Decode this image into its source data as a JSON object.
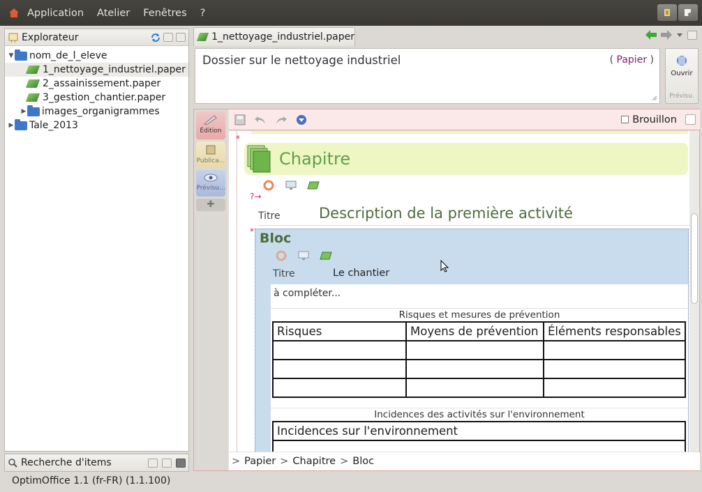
{
  "menubar": {
    "items": [
      "Application",
      "Atelier",
      "Fenêtres",
      "?"
    ]
  },
  "explorer": {
    "title": "Explorateur",
    "tree": [
      {
        "label": "nom_de_l_eleve",
        "type": "folder",
        "level": 0,
        "expanded": true
      },
      {
        "label": "1_nettoyage_industriel.paper",
        "type": "paper",
        "level": 1,
        "selected": true
      },
      {
        "label": "2_assainissement.paper",
        "type": "paper",
        "level": 1
      },
      {
        "label": "3_gestion_chantier.paper",
        "type": "paper",
        "level": 1
      },
      {
        "label": "images_organigrammes",
        "type": "folder",
        "level": 1,
        "expanded": false
      },
      {
        "label": "Tale_2013",
        "type": "folder",
        "level": 0,
        "expanded": false
      }
    ]
  },
  "search_panel": {
    "title": "Recherche d'items"
  },
  "status": {
    "text": "OptimOffice 1.1 (fr-FR) (1.1.100)"
  },
  "tab": {
    "label": "1_nettoyage_industriel.paper"
  },
  "header": {
    "title": "Dossier sur le nettoyage industriel",
    "kind_open": "(",
    "kind": "Papier",
    "kind_close": ")"
  },
  "open_button": {
    "label": "Ouvrir",
    "sub": "Prévisu."
  },
  "sidebar": {
    "edition": "Édition",
    "publication": "Publica...",
    "preview": "Prévisu..."
  },
  "toolbar": {
    "brouillon": "Brouillon"
  },
  "chapter": {
    "label": "Chapitre"
  },
  "title_field": {
    "label": "Titre",
    "value": "Description de la première activité"
  },
  "bloc": {
    "label": "Bloc",
    "title_label": "Titre",
    "title_value": "Le chantier",
    "todo": "à compléter...",
    "table1": {
      "caption": "Risques et mesures de prévention",
      "headers": [
        "Risques",
        "Moyens de prévention",
        "Éléments responsables"
      ]
    },
    "table2": {
      "caption": "Incidences des activités sur l'environnement",
      "headers": [
        "Incidences sur l'environnement"
      ]
    }
  },
  "breadcrumb": {
    "items": [
      "Papier",
      "Chapitre",
      "Bloc"
    ],
    "prefix": ">"
  },
  "colors": {
    "menubar": "#3d3c38",
    "chapter_bg": "#eef7c4",
    "bloc_bg": "#c8dcee",
    "edition_btn": "#e9a9a9",
    "accent_purple": "#7a1f6e"
  }
}
